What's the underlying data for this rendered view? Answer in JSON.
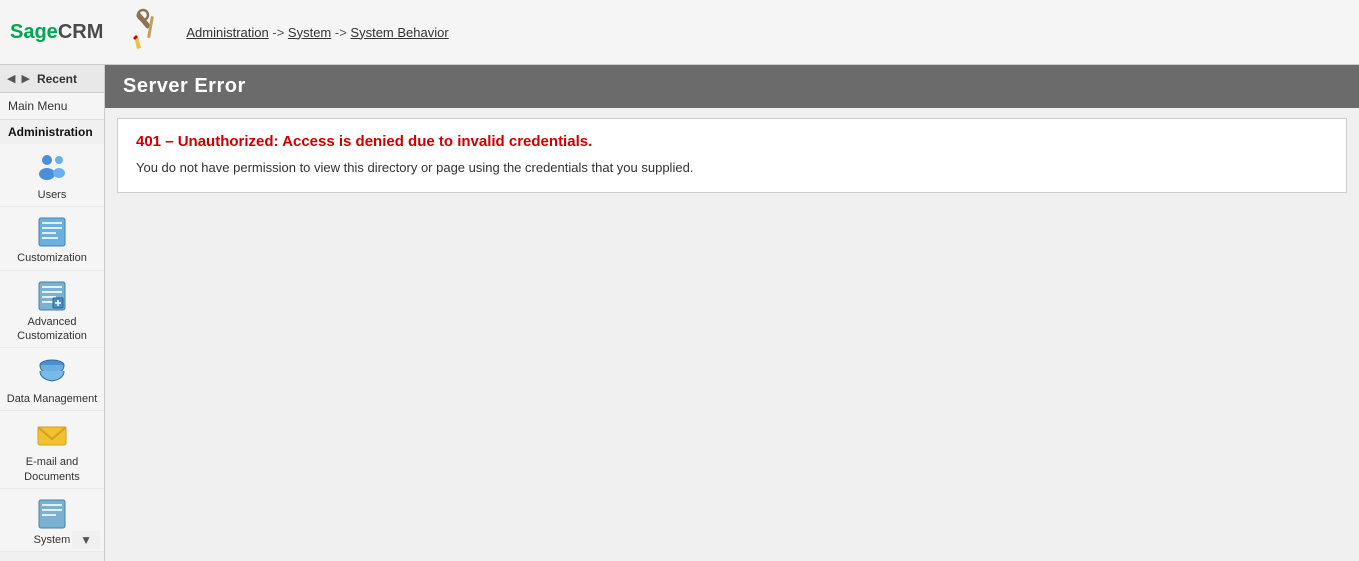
{
  "topbar": {
    "logo": "SageCRM",
    "breadcrumb": {
      "admin": "Administration",
      "system": "System",
      "system_behavior": "System Behavior",
      "separator": "->"
    }
  },
  "sidebar": {
    "recent_label": "Recent",
    "main_menu_label": "Main Menu",
    "admin_section_label": "Administration",
    "items": [
      {
        "id": "users",
        "label": "Users",
        "icon": "users-icon"
      },
      {
        "id": "customization",
        "label": "Customization",
        "icon": "customization-icon"
      },
      {
        "id": "advanced-customization",
        "label": "Advanced Customization",
        "icon": "adv-customization-icon"
      },
      {
        "id": "data-management",
        "label": "Data Management",
        "icon": "data-management-icon"
      },
      {
        "id": "email-and-documents",
        "label": "E-mail and Documents",
        "icon": "email-docs-icon"
      },
      {
        "id": "system",
        "label": "System",
        "icon": "system-icon"
      }
    ]
  },
  "main": {
    "error_header": "Server Error",
    "error_title": "401 – Unauthorized: Access is denied due to invalid credentials.",
    "error_description": "You do not have permission to view this directory or page using the credentials that you supplied."
  }
}
